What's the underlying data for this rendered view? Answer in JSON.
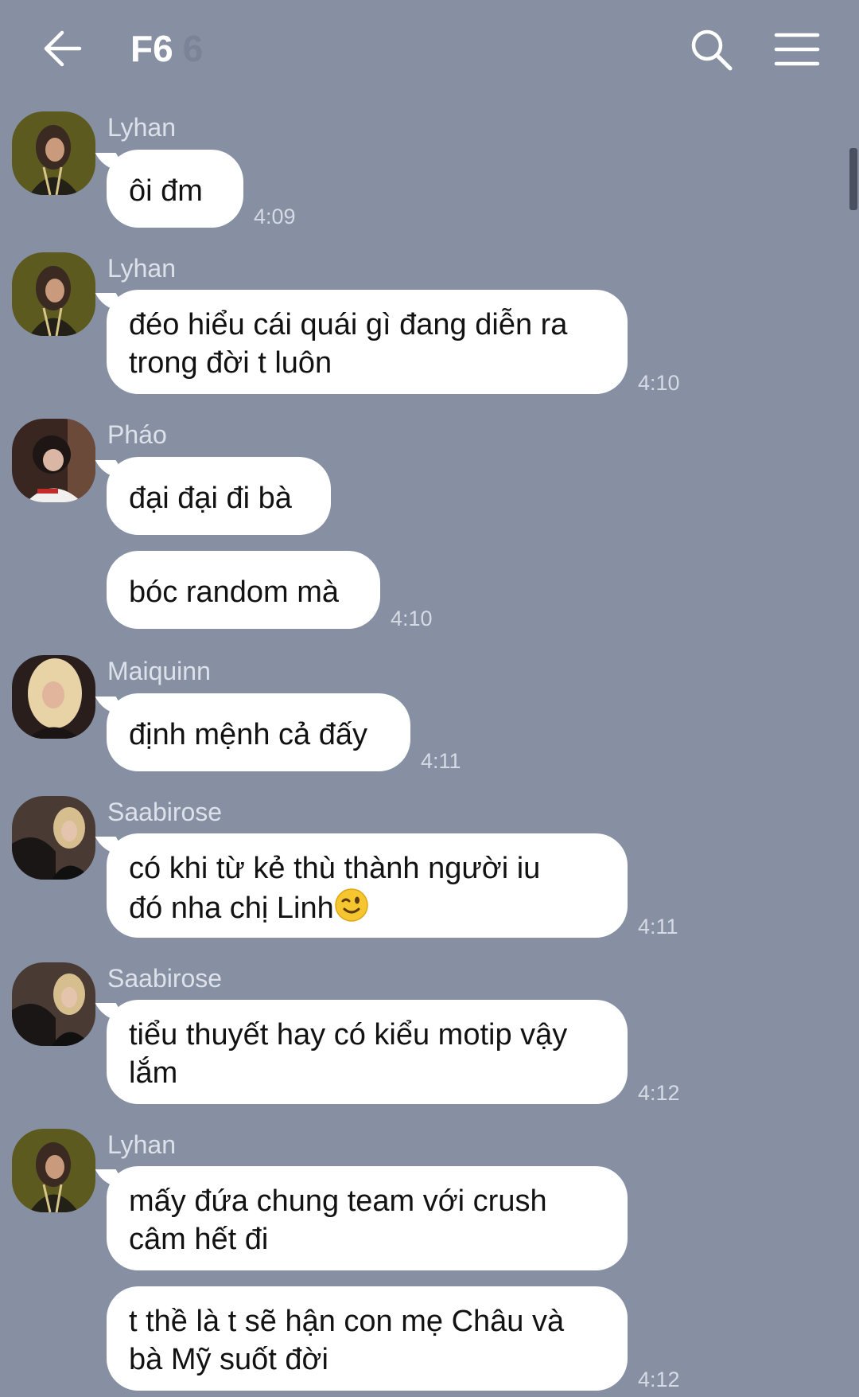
{
  "header": {
    "back_icon": "arrow-left-icon",
    "title": "F6",
    "member_count": "6",
    "search_icon": "search-icon",
    "menu_icon": "hamburger-menu-icon"
  },
  "messages": [
    {
      "sender": "Lyhan",
      "text": "ôi đm",
      "time": "4:09"
    },
    {
      "sender": "Lyhan",
      "text_line1": "đéo hiểu cái quái gì đang diễn ra",
      "text_line2": "trong đời t luôn",
      "time": "4:10"
    },
    {
      "sender": "Pháo",
      "text": "đại đại đi bà",
      "text2": "bóc random mà",
      "time": "4:10"
    },
    {
      "sender": "Maiquinn",
      "text": "định mệnh cả đấy",
      "time": "4:11"
    },
    {
      "sender": "Saabirose",
      "text_line1": "có khi từ kẻ thù thành người iu",
      "text_line2": "đó nha chị Linh",
      "emoji_icon": "winking-face-icon",
      "time": "4:11"
    },
    {
      "sender": "Saabirose",
      "text_line1": "tiểu thuyết hay có kiểu motip vậy",
      "text_line2": "lắm",
      "time": "4:12"
    },
    {
      "sender": "Lyhan",
      "text_line1": "mấy đứa chung team với crush",
      "text_line2": "câm hết đi",
      "text3_line1": "t thề là t sẽ hận con mẹ Châu và",
      "text3_line2": "bà Mỹ suốt đời",
      "time": "4:12"
    }
  ]
}
